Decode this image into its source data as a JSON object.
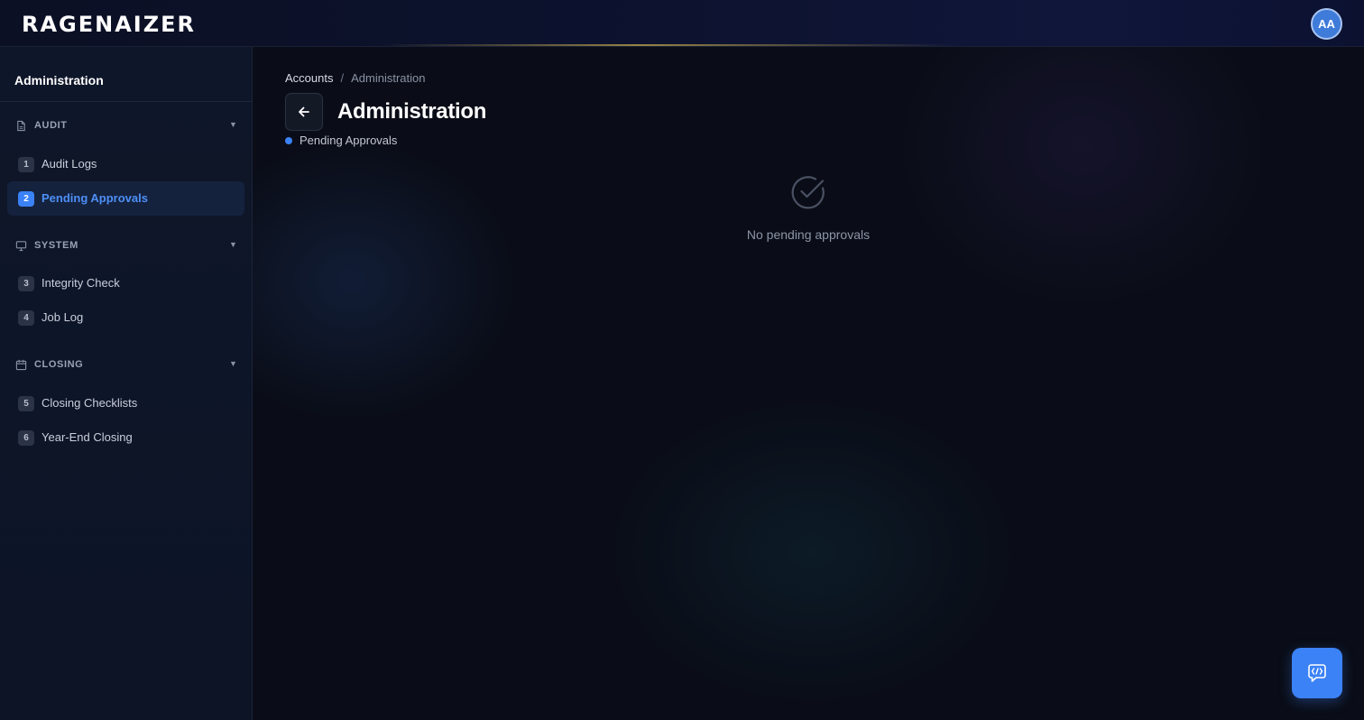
{
  "header": {
    "logo_text": "RAGENAIZER",
    "user_initials": "AA"
  },
  "sidebar": {
    "title": "Administration",
    "sections": [
      {
        "label": "AUDIT",
        "icon": "document-icon",
        "items": [
          {
            "number": "1",
            "label": "Audit Logs",
            "active": false
          },
          {
            "number": "2",
            "label": "Pending Approvals",
            "active": true
          }
        ]
      },
      {
        "label": "SYSTEM",
        "icon": "monitor-icon",
        "items": [
          {
            "number": "3",
            "label": "Integrity Check",
            "active": false
          },
          {
            "number": "4",
            "label": "Job Log",
            "active": false
          }
        ]
      },
      {
        "label": "CLOSING",
        "icon": "calendar-icon",
        "items": [
          {
            "number": "5",
            "label": "Closing Checklists",
            "active": false
          },
          {
            "number": "6",
            "label": "Year-End Closing",
            "active": false
          }
        ]
      }
    ]
  },
  "main": {
    "breadcrumb": {
      "root": "Accounts",
      "separator": "/",
      "current": "Administration"
    },
    "title": "Administration",
    "active_tab": "Pending Approvals",
    "empty_state": {
      "icon": "check-circle-icon",
      "message": "No pending approvals"
    }
  },
  "colors": {
    "accent": "#3b82f6",
    "background": "#0a0d17",
    "sidebar_bg": "#0e1629"
  }
}
